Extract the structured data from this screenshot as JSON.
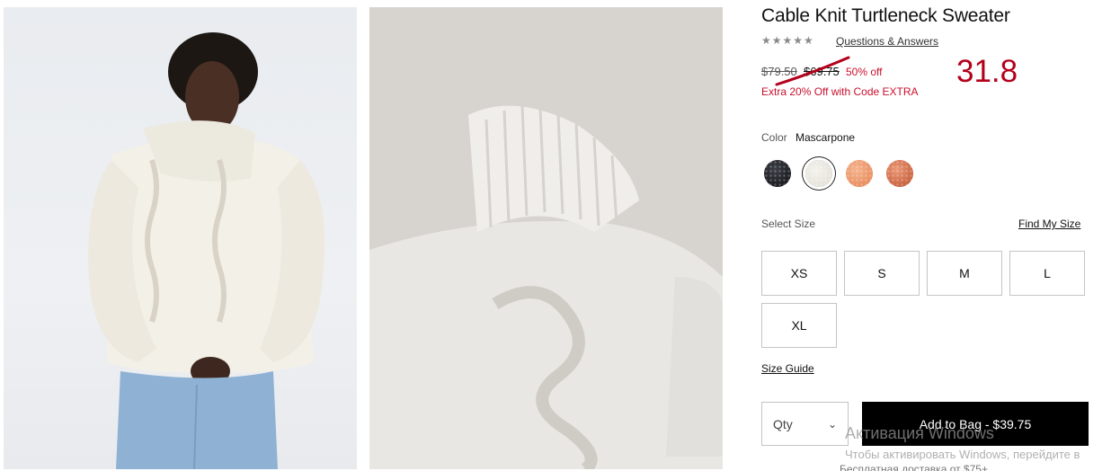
{
  "product": {
    "title": "Cable Knit Turtleneck Sweater",
    "rating_stars": "★★★★★",
    "qa_link": "Questions & Answers"
  },
  "pricing": {
    "original_price": "$79.50",
    "sale_price": "$69.75",
    "discount": "50% off",
    "promo": "Extra 20% Off with Code EXTRA",
    "annotation_number": "31.8"
  },
  "color": {
    "label": "Color",
    "selected": "Mascarpone",
    "swatches": [
      "black-swatch",
      "mascarpone-swatch",
      "peach-swatch",
      "coral-swatch"
    ],
    "swatch_colors": [
      "#1b1d22",
      "#eceae3",
      "#ee9f74",
      "#d4714e"
    ]
  },
  "size": {
    "label": "Select Size",
    "find_my_size": "Find My Size",
    "options": [
      "XS",
      "S",
      "M",
      "L",
      "XL"
    ],
    "guide": "Size Guide"
  },
  "cart": {
    "qty_label": "Qty",
    "add_to_bag": "Add to Bag - $39.75"
  },
  "overlay": {
    "watermark_title": "Активация Windows",
    "watermark_text": "Чтобы активировать Windows, перейдите в",
    "cut_text": "Бесплатная доставка от $75+"
  },
  "colors": {
    "sale_red": "#c8102e",
    "annotation_red": "#b3001b",
    "button_black": "#000000"
  }
}
